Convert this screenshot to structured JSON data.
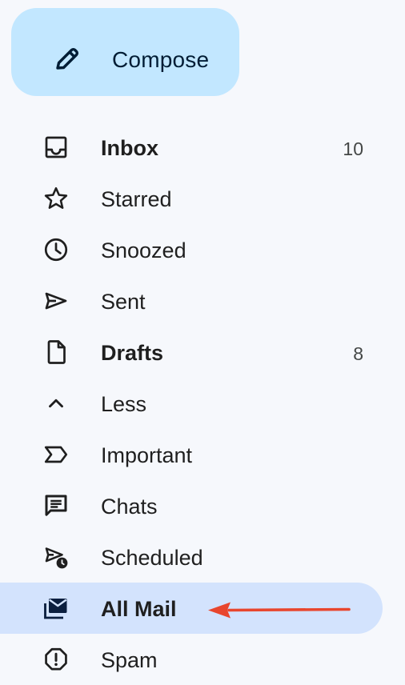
{
  "compose": {
    "label": "Compose",
    "icon": "pencil-icon",
    "background": "#c2e7ff"
  },
  "nav": {
    "items": [
      {
        "label": "Inbox",
        "count": "10",
        "icon": "inbox-icon",
        "bold": true
      },
      {
        "label": "Starred",
        "icon": "star-icon"
      },
      {
        "label": "Snoozed",
        "icon": "clock-icon"
      },
      {
        "label": "Sent",
        "icon": "send-icon"
      },
      {
        "label": "Drafts",
        "count": "8",
        "icon": "draft-icon",
        "bold": true
      },
      {
        "label": "Less",
        "icon": "chevron-up-icon"
      },
      {
        "label": "Important",
        "icon": "important-icon"
      },
      {
        "label": "Chats",
        "icon": "chat-icon"
      },
      {
        "label": "Scheduled",
        "icon": "scheduled-send-icon"
      },
      {
        "label": "All Mail",
        "icon": "all-mail-icon",
        "bold": true,
        "selected": true
      },
      {
        "label": "Spam",
        "icon": "spam-icon"
      }
    ]
  },
  "annotation": {
    "arrow_color": "#e8462e",
    "points_to": "All Mail"
  },
  "colors": {
    "sidebar_background": "#f6f8fc",
    "selected_background": "#d3e3fd",
    "text": "#1f1f1f",
    "count": "#444746"
  }
}
